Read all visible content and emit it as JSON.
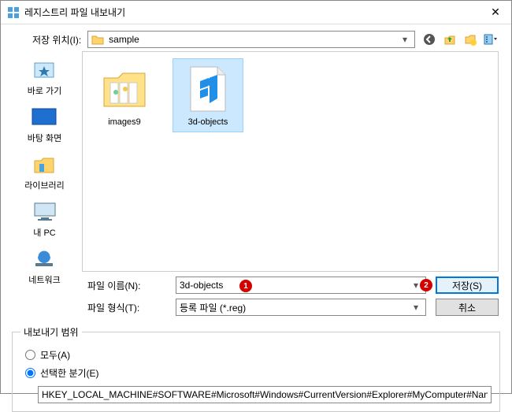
{
  "window": {
    "title": "레지스트리 파일 내보내기"
  },
  "toprow": {
    "label": "저장 위치(I):",
    "location": "sample"
  },
  "sidebar": {
    "items": [
      {
        "label": "바로 가기"
      },
      {
        "label": "바탕 화면"
      },
      {
        "label": "라이브러리"
      },
      {
        "label": "내 PC"
      },
      {
        "label": "네트워크"
      }
    ]
  },
  "files": {
    "items": [
      {
        "label": "images9",
        "type": "folder",
        "selected": false
      },
      {
        "label": "3d-objects",
        "type": "regfile",
        "selected": true
      }
    ]
  },
  "bottom": {
    "filename_label": "파일 이름(N):",
    "filename_value": "3d-objects",
    "filetype_label": "파일 형식(T):",
    "filetype_value": "등록 파일 (*.reg)",
    "save_label": "저장(S)",
    "cancel_label": "취소"
  },
  "range": {
    "legend": "내보내기 범위",
    "all_label": "모두(A)",
    "selected_label": "선택한 분기(E)",
    "path_value": "HKEY_LOCAL_MACHINE#SOFTWARE#Microsoft#Windows#CurrentVersion#Explorer#MyComputer#Nan"
  },
  "annotations": {
    "badge1": "1",
    "badge2": "2"
  }
}
